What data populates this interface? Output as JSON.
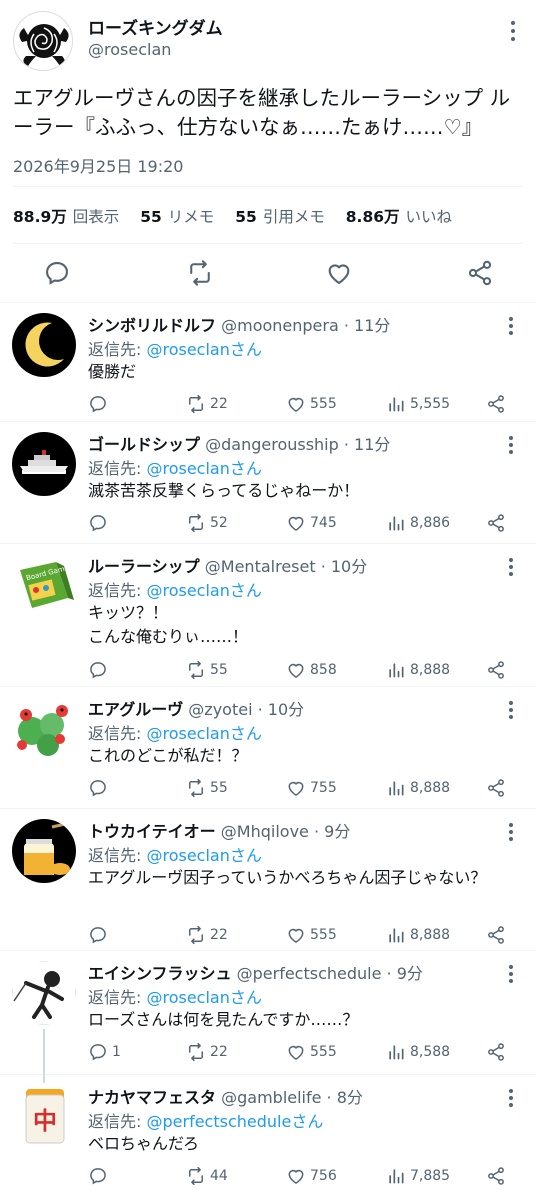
{
  "main": {
    "name": "ローズキングダム",
    "handle": "@roseclan",
    "text": "エアグルーヴさんの因子を継承したルーラーシップ ルーラー『ふふっ、仕方ないなぁ……たぁけ……♡』",
    "time": "2026年9月25日 19:20",
    "stats": {
      "views": "88.9万",
      "views_label": "回表示",
      "reposts": "55",
      "reposts_label": "リメモ",
      "quotes": "55",
      "quotes_label": "引用メモ",
      "likes": "8.86万",
      "likes_label": "いいね"
    }
  },
  "replies": [
    {
      "name": "シンボリルドルフ",
      "meta": "@moonenpera · 11分",
      "reply_prefix": "返信先: ",
      "reply_to": "@roseclanさん",
      "text": "優勝だ",
      "comments": "",
      "reposts": "22",
      "likes": "555",
      "views": "5,555",
      "avatar": "moon-avatar"
    },
    {
      "name": "ゴールドシップ",
      "meta": "@dangerousship · 11分",
      "reply_prefix": "返信先: ",
      "reply_to": "@roseclanさん",
      "text": "滅茶苦茶反撃くらってるじゃねーか！",
      "comments": "",
      "reposts": "52",
      "likes": "745",
      "views": "8,886",
      "avatar": "ship-avatar"
    },
    {
      "name": "ルーラーシップ",
      "meta": "@Mentalreset · 10分",
      "reply_prefix": "返信先: ",
      "reply_to": "@roseclanさん",
      "text": "キッツ？！\nこんな俺むりぃ……！",
      "comments": "",
      "reposts": "55",
      "likes": "858",
      "views": "8,888",
      "avatar": "board-game-avatar",
      "avatar_text": "Board Game"
    },
    {
      "name": "エアグルーヴ",
      "meta": "@zyotei · 10分",
      "reply_prefix": "返信先: ",
      "reply_to": "@roseclanさん",
      "text": "これのどこが私だ！？",
      "comments": "",
      "reposts": "55",
      "likes": "755",
      "views": "8,888",
      "avatar": "ladybug-avatar"
    },
    {
      "name": "トウカイテイオー",
      "meta": "@Mhqilove · 9分",
      "reply_prefix": "返信先: ",
      "reply_to": "@roseclanさん",
      "text": "エアグルーヴ因子っていうかべろちゃん因子じゃない？",
      "comments": "",
      "reposts": "22",
      "likes": "555",
      "views": "8,888",
      "avatar": "honey-avatar"
    },
    {
      "name": "エイシンフラッシュ",
      "meta": "@perfectschedule · 9分",
      "reply_prefix": "返信先: ",
      "reply_to": "@roseclanさん",
      "text": "ローズさんは何を見たんですか……？",
      "comments": "1",
      "reposts": "22",
      "likes": "555",
      "views": "8,588",
      "avatar": "fencer-avatar"
    },
    {
      "name": "ナカヤマフェスタ",
      "meta": "@gamblelife · 8分",
      "reply_prefix": "返信先: ",
      "reply_to": "@perfectscheduleさん",
      "text": "ベロちゃんだろ",
      "comments": "",
      "reposts": "44",
      "likes": "756",
      "views": "7,885",
      "avatar": "mahjong-avatar",
      "avatar_text": "中"
    }
  ],
  "colors": {
    "accent": "#1d9bf0",
    "muted": "#536471",
    "text": "#0f1419"
  }
}
